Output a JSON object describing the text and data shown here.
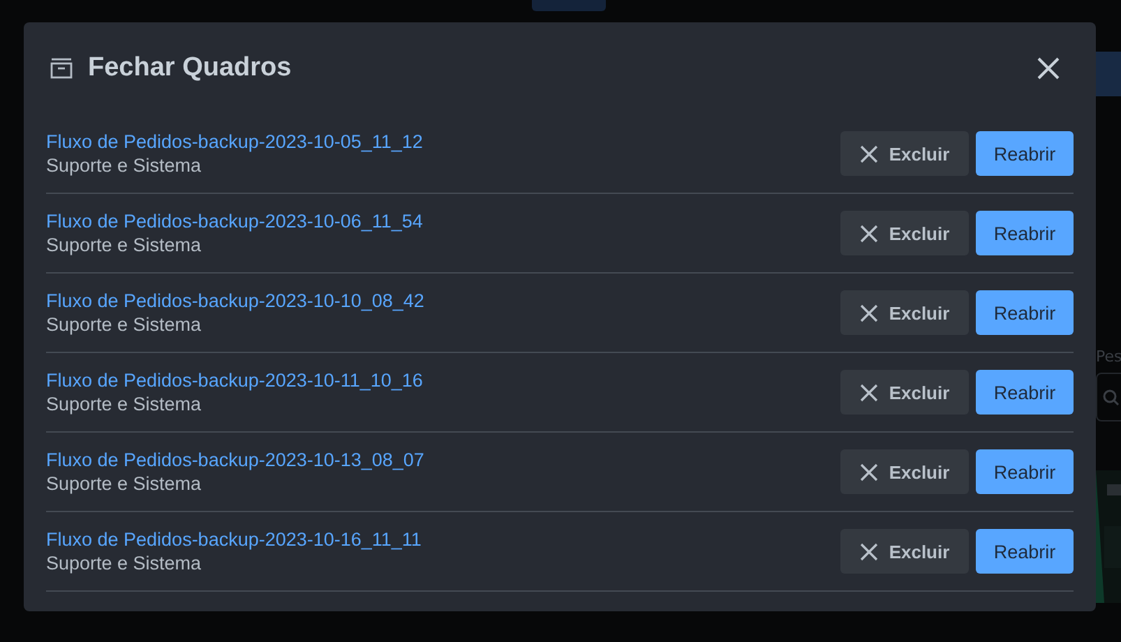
{
  "backdrop": {
    "field_label": "Pes"
  },
  "dialog": {
    "title": "Fechar Quadros",
    "items": [
      {
        "name": "Fluxo de Pedidos-backup-2023-10-05_11_12",
        "team": "Suporte e Sistema",
        "delete": "Excluir",
        "reopen": "Reabrir"
      },
      {
        "name": "Fluxo de Pedidos-backup-2023-10-06_11_54",
        "team": "Suporte e Sistema",
        "delete": "Excluir",
        "reopen": "Reabrir"
      },
      {
        "name": "Fluxo de Pedidos-backup-2023-10-10_08_42",
        "team": "Suporte e Sistema",
        "delete": "Excluir",
        "reopen": "Reabrir"
      },
      {
        "name": "Fluxo de Pedidos-backup-2023-10-11_10_16",
        "team": "Suporte e Sistema",
        "delete": "Excluir",
        "reopen": "Reabrir"
      },
      {
        "name": "Fluxo de Pedidos-backup-2023-10-13_08_07",
        "team": "Suporte e Sistema",
        "delete": "Excluir",
        "reopen": "Reabrir"
      },
      {
        "name": "Fluxo de Pedidos-backup-2023-10-16_11_11",
        "team": "Suporte e Sistema",
        "delete": "Excluir",
        "reopen": "Reabrir"
      }
    ]
  }
}
